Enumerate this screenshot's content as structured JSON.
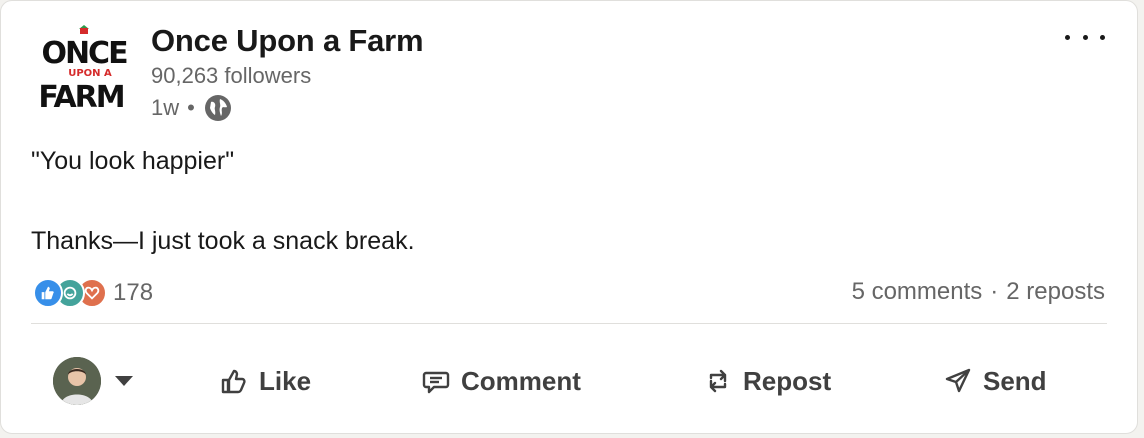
{
  "post": {
    "author": {
      "name": "Once Upon a Farm",
      "followers": "90,263 followers",
      "time": "1w",
      "separator": "•",
      "logo_lines": [
        "ONCE",
        "UPON A",
        "FARM"
      ]
    },
    "text_lines": [
      "\"You look happier\"",
      "Thanks—I just took a snack break."
    ],
    "reactions": {
      "icons": [
        "like-icon",
        "celebrate-icon",
        "love-icon"
      ],
      "count": "178"
    },
    "stats": {
      "comments": "5 comments",
      "separator": "·",
      "reposts": "2 reposts"
    }
  },
  "actions": {
    "like": "Like",
    "comment": "Comment",
    "repost": "Repost",
    "send": "Send"
  },
  "colors": {
    "like": "#378fe9",
    "celebrate": "#44a39b",
    "love": "#df704d",
    "logo_red": "#d52b2b",
    "logo_green": "#2e9a4a"
  }
}
